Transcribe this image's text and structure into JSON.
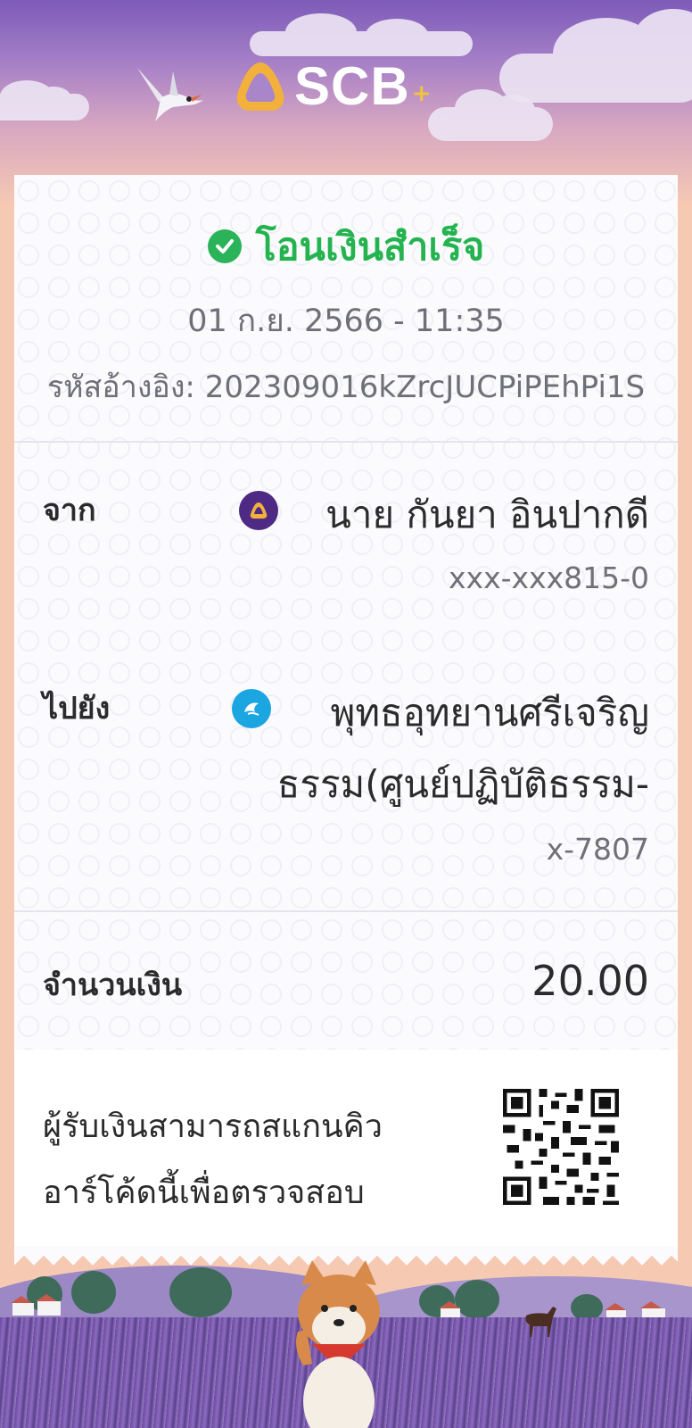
{
  "brand": {
    "logo_text": "SCB",
    "logo_plus": "+",
    "colors": {
      "primary": "#4e2a84",
      "gold": "#f2b13d",
      "success": "#24b34f"
    }
  },
  "receipt": {
    "status": "โอนเงินสำเร็จ",
    "datetime": "01 ก.ย. 2566 - 11:35",
    "reference_label": "รหัสอ้างอิง:",
    "reference": "202309016kZrcJUCPiPEhPi1S",
    "from": {
      "label": "จาก",
      "name": "นาย กันยา อินปากดี",
      "account": "xxx-xxx815-0",
      "bank_icon": "scb-bank-icon"
    },
    "to": {
      "label": "ไปยัง",
      "name_line1": "พุทธอุทยานศรีเจริญ",
      "name_line2": "ธรรม(ศูนย์ปฏิบัติธรรม-",
      "account": "x-7807",
      "bank_icon": "ktb-bank-icon"
    },
    "amount": {
      "label": "จำนวนเงิน",
      "value": "20.00"
    },
    "verify": {
      "line1": "ผู้รับเงินสามารถสแกนคิว",
      "line2": "อาร์โค้ดนี้เพื่อตรวจสอบ"
    }
  }
}
